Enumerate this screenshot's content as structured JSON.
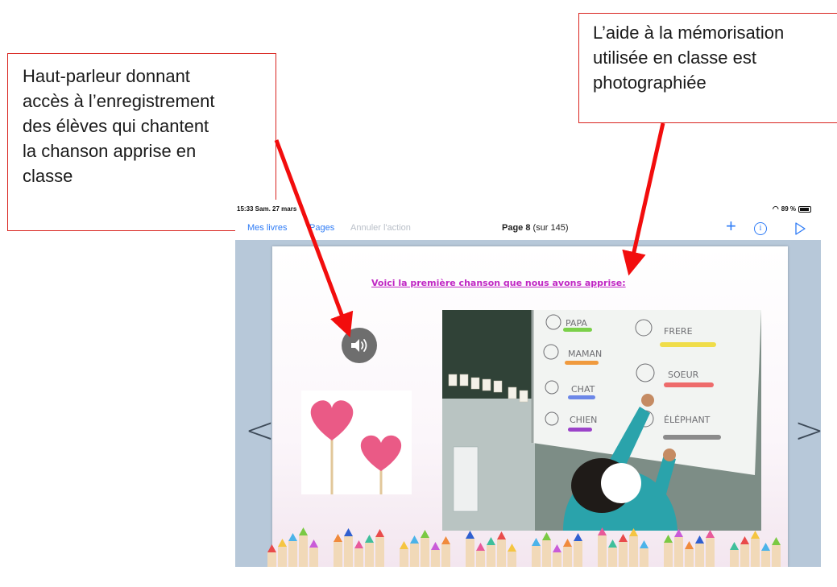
{
  "annotations": {
    "left_callout": "Haut-parleur donnant\naccès à l’enregistrement\ndes élèves qui chantent\nla chanson apprise en\nclasse",
    "right_callout": "L’aide à la mémorisation\nutilisée en classe est\nphotographiée",
    "accent_color": "#d9241f"
  },
  "status_bar": {
    "time": "15:33  Sam. 27 mars",
    "battery": "89 %"
  },
  "nav": {
    "mes_livres": "Mes livres",
    "pages": "Pages",
    "annuler": "Annuler l'action",
    "page_label": "Page 8",
    "page_total": "(sur 145)",
    "icons": [
      "plus-icon",
      "info-icon",
      "play-icon"
    ]
  },
  "page": {
    "heading": "Voici la première chanson que nous avons apprise:",
    "heading_color": "#c027c4",
    "speaker_icon": "speaker-icon",
    "whiteboard_words": [
      "PAPA",
      "MAMAN",
      "CHAT",
      "CHIEN",
      "FRERE",
      "SOEUR",
      "ÉLÉPHANT"
    ]
  },
  "navigation_icons": [
    "chevron-left-icon",
    "chevron-right-icon"
  ]
}
